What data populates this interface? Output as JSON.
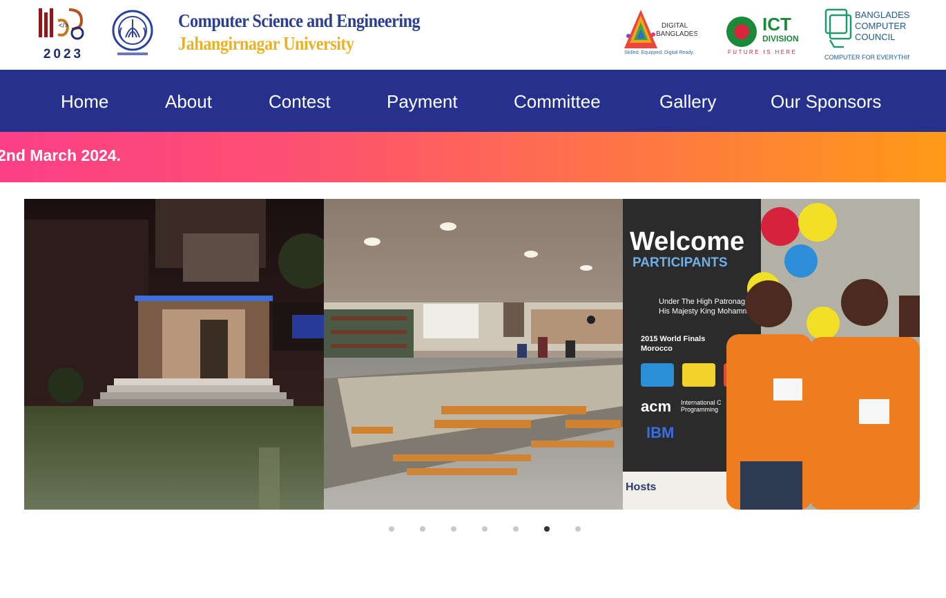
{
  "header": {
    "dept_line1": "Computer Science and Engineering",
    "dept_line2": "Jahangirnagar University",
    "iupc_year": "2023",
    "digital_bd": {
      "title_line1": "DIGITAL",
      "title_line2": "BANGLADESH",
      "tagline": "Skilled. Equipped. Digital Ready."
    },
    "ict": {
      "title": "ICT",
      "subtitle": "DIVISION",
      "tagline": "FUTURE IS HERE"
    },
    "bcc": {
      "line1": "BANGLADESH",
      "line2": "COMPUTER",
      "line3": "COUNCIL",
      "tagline": "COMPUTER FOR EVERYTHING"
    }
  },
  "nav": {
    "items": [
      {
        "label": "Home"
      },
      {
        "label": "About"
      },
      {
        "label": "Contest"
      },
      {
        "label": "Payment"
      },
      {
        "label": "Committee"
      },
      {
        "label": "Gallery"
      },
      {
        "label": "Our Sponsors"
      }
    ]
  },
  "marquee": {
    "text": "2nd March 2024."
  },
  "carousel": {
    "banner": {
      "welcome": "Welcome",
      "participants": "PARTICIPANTS",
      "patronage_line1": "Under The High Patronag",
      "patronage_line2": "His Majesty King Mohammed",
      "finals_line1": "2015 World Finals",
      "finals_line2": "Morocco",
      "acm": "acm",
      "acm_sub1": "International C",
      "acm_sub2": "Programming",
      "ibm": "IBM",
      "hosts": "Hosts"
    },
    "dot_count": 7,
    "active_index": 5
  },
  "colors": {
    "nav_bg": "#25318c",
    "marquee_start": "#fc3f86",
    "marquee_end": "#ff9a17",
    "dept_blue": "#2a3f8f",
    "dept_gold": "#e9b327"
  }
}
